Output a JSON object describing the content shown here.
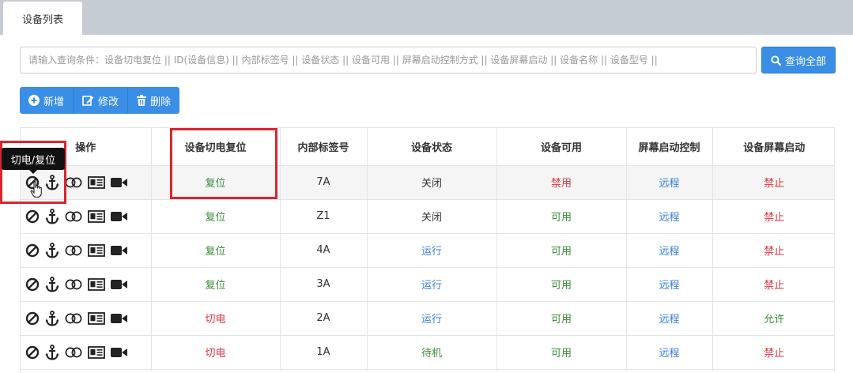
{
  "tabs": [
    {
      "label": "设备列表"
    }
  ],
  "search": {
    "placeholder": "请输入查询条件：设备切电复位 || ID(设备信息) || 内部标签号 || 设备状态 || 设备可用 || 屏幕启动控制方式 || 设备屏幕启动 || 设备名称 || 设备型号 ||",
    "query_all_label": "查询全部"
  },
  "toolbar": {
    "add_label": "新增",
    "edit_label": "修改",
    "delete_label": "删除"
  },
  "tooltip": "切电/复位",
  "table": {
    "headers": [
      "操作",
      "设备切电复位",
      "内部标签号",
      "设备状态",
      "设备可用",
      "屏幕启动控制",
      "设备屏幕启动"
    ],
    "rows": [
      {
        "reset": "复位",
        "tag": "7A",
        "status": "关闭",
        "available": "禁用",
        "control": "远程",
        "screen": "禁止"
      },
      {
        "reset": "复位",
        "tag": "Z1",
        "status": "关闭",
        "available": "可用",
        "control": "远程",
        "screen": "禁止"
      },
      {
        "reset": "复位",
        "tag": "4A",
        "status": "运行",
        "available": "可用",
        "control": "远程",
        "screen": "禁止"
      },
      {
        "reset": "复位",
        "tag": "3A",
        "status": "运行",
        "available": "可用",
        "control": "远程",
        "screen": "禁止"
      },
      {
        "reset": "切电",
        "tag": "2A",
        "status": "运行",
        "available": "可用",
        "control": "远程",
        "screen": "允许"
      },
      {
        "reset": "切电",
        "tag": "1A",
        "status": "待机",
        "available": "可用",
        "control": "远程",
        "screen": "禁止"
      }
    ]
  },
  "row_icons": [
    "ban-icon",
    "anchor-icon",
    "toggle-icon",
    "id-card-icon",
    "video-camera-icon"
  ],
  "colors": {
    "primary": "#3a8ee6",
    "green": "#3a8a3a",
    "red": "#d9363e",
    "blue": "#3a7fd5",
    "highlight_box": "#d9262c"
  }
}
